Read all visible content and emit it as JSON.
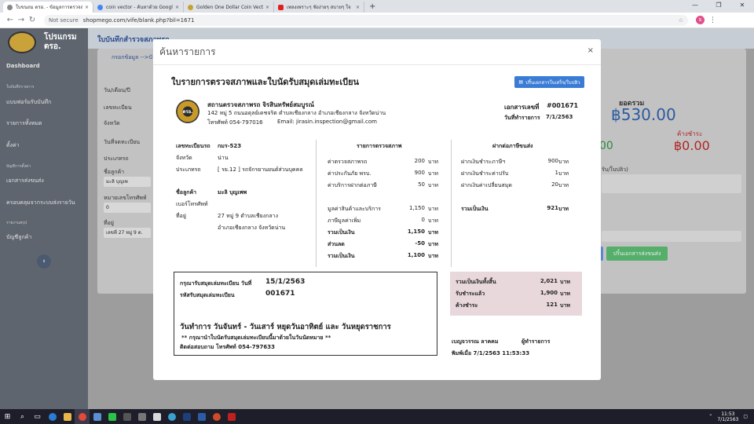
{
  "browser": {
    "tabs": [
      {
        "title": "ใบขนถม ตรอ. - ข้อมูลการตรวจสภาพ",
        "close": "×"
      },
      {
        "title": "coin vector - ค้นหาด้วย Google",
        "close": "×"
      },
      {
        "title": "Golden One Dollar Coin Vector I",
        "close": "×"
      },
      {
        "title": "เพลงเพราะๆ ฟังง่ายๆ สบายๆ ใจ",
        "close": "×"
      }
    ],
    "new_tab": "+",
    "url_prefix": "Not secure",
    "url": "shopmego.com/vife/blank.php?bil=1671",
    "profile_initial": "s"
  },
  "sidebar": {
    "title_line1": "โปรแกรม",
    "title_line2": "ตรอ.",
    "items": [
      "Dashboard",
      "แบบฟอร์มรับบันทึก",
      "รายการทั้งหมด",
      "ตั้งค่า",
      "เอกสารส่งขนส่ง",
      "ครอบคลุมจากระบบส่งรายวัน",
      "บัญชีลูกค้า"
    ],
    "heads": [
      "ใบบันทึกรายการ",
      "บัญชีการตั้งค่า",
      "รายงานสรุป"
    ]
  },
  "topbar": {
    "title": "ใบบันทึกสำรวจสภาพรถ"
  },
  "background": {
    "crumb": "กรอกข้อมูล -->บั",
    "labels": [
      "วัน/เดือน/ปี",
      "เลขทะเบียน",
      "จังหวัด",
      "วันที่จดทะเบียน",
      "ประเภทรถ",
      "ชื่อลูกค้า",
      "หมายเลขโทรศัพท์",
      "ที่อยู่"
    ],
    "customer": "มะลิ บุญเพ",
    "zero": "0",
    "address": "เลขที่ 27 หมู่ 9 ต.",
    "total_label": "ยอดรวม",
    "total": "฿530.00",
    "due_label": "ค้างชำระ",
    "due": "฿0.00",
    "paid": "00",
    "hint": "รับ/ใบปลิว)",
    "send_button": "ปริ้นเอกสารส่งขนส่ง"
  },
  "modal": {
    "title": "ค้นหารายการ",
    "close": "×",
    "report_title": "ใบรายการตรวจสภาพและใบนัดรับสมุดเล่มทะเบียน",
    "print_button": "ปริ้นเอกสารใบเสร็จ/ใบปลิว",
    "logo_text": "ตรอ.",
    "station": {
      "name": "สถานตรวจสภาพรถ จิรสินทรัพย์สมบูรณ์",
      "address": "142 หมู่ 5 ถนนอดุลย์เดชจริต ตำบลเชียงกลาง อำเภอเชียงกลาง จังหวัดน่าน",
      "phone": "โทรศัพท์ 054-797016",
      "email": "Email: jirasin.inspection@gmail.com"
    },
    "doc_no_label": "เอกสารเลขที่",
    "doc_no": "#001671",
    "doc_date_label": "วันที่ทำรายการ",
    "doc_date": "7/1/2563",
    "vehicle": {
      "reg_label": "เลขทะเบียนรถ",
      "reg": "กมร-523",
      "province_label": "จังหวัด",
      "province": "น่าน",
      "type_label": "ประเภทรถ",
      "type": "[ รย.12 ] รถจักรยานยนต์ส่วนบุคคล",
      "customer_label": "ชื่อลูกค้า",
      "customer": "มะลิ บุญเพพ",
      "phone_label": "เบอร์โทรศัพท์",
      "phone": "",
      "addr_label": "ที่อยู่",
      "addr1": "27 หมู่ 9 ตำบลเชียงกลาง",
      "addr2": "อำเภอเชียงกลาง จังหวัดน่าน"
    },
    "inspection": {
      "header": "รายการตรวจสภาพ",
      "rows": [
        {
          "label": "ค่าตรวจสภาพรถ",
          "value": "200",
          "unit": "บาท"
        },
        {
          "label": "ค่าประกันภัย พรบ.",
          "value": "900",
          "unit": "บาท"
        },
        {
          "label": "ค่าบริการฝากต่อภาษี",
          "value": "50",
          "unit": "บาท"
        }
      ],
      "rows2": [
        {
          "label": "มูลค่าสินค้าและบริการ",
          "value": "1,150",
          "unit": "บาท"
        },
        {
          "label": "ภาษีมูลค่าเพิ่ม",
          "value": "0",
          "unit": "บาท"
        }
      ],
      "rows3": [
        {
          "label": "รวมเป็นเงิน",
          "value": "1,150",
          "unit": "บาท"
        },
        {
          "label": "ส่วนลด",
          "value": "-50",
          "unit": "บาท"
        },
        {
          "label": "รวมเป็นเงิน",
          "value": "1,100",
          "unit": "บาท"
        }
      ]
    },
    "tax": {
      "header": "ฝากต่อภาษีขนส่ง",
      "rows": [
        {
          "label": "ฝากเงินชำระภาษีฯ",
          "value": "900",
          "unit": "บาท"
        },
        {
          "label": "ฝากเงินชำระค่าปรับ",
          "value": "1",
          "unit": "บาท"
        },
        {
          "label": "ฝากเงินค่าเปลี่ยนสมุด",
          "value": "20",
          "unit": "บาท"
        }
      ],
      "total": {
        "label": "รวมเป็นเงิน",
        "value": "921",
        "unit": "บาท"
      }
    },
    "appointment": {
      "receive_label": "กรุณารับสมุดเล่มทะเบียน วันที่",
      "receive_date": "15/1/2563",
      "code_label": "รหัสรับสมุดเล่มทะเบียน",
      "code": "001671",
      "hours": "วันทำการ วันจันทร์ - วันเสาร์ หยุดวันอาทิตย์ และ วันหยุดราชการ",
      "note": "** กรุณานำใบนัดรับสมุดเล่มทะเบียนนี้มาด้วยในวันนัดหมาย **",
      "contact": "ติดต่อสอบถาม โทรศัพท์ 054-797633"
    },
    "summary": [
      {
        "label": "รวมเป็นเงินทั้งสิ้น",
        "value": "2,021",
        "unit": "บาท"
      },
      {
        "label": "รับชำระแล้ว",
        "value": "1,900",
        "unit": "บาท"
      },
      {
        "label": "ค้างชำระ",
        "value": "121",
        "unit": "บาท"
      }
    ],
    "staff": {
      "name": "เบญจวรรณ ลาคคม",
      "role": "ผู้ทำรายการ",
      "printed": "พิมพ์เมื่อ 7/1/2563 11:53:33"
    }
  },
  "taskbar": {
    "time": "11:53",
    "date": "7/1/2563"
  }
}
